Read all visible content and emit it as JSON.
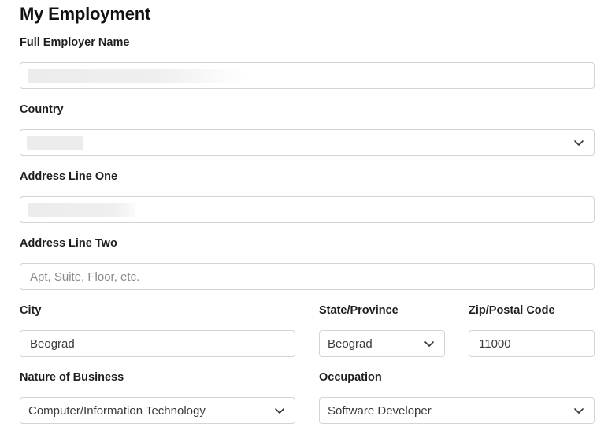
{
  "page": {
    "title": "My Employment"
  },
  "form": {
    "employer_name": {
      "label": "Full Employer Name",
      "value": ""
    },
    "country": {
      "label": "Country",
      "value": ""
    },
    "address_one": {
      "label": "Address Line One",
      "value": ""
    },
    "address_two": {
      "label": "Address Line Two",
      "placeholder": "Apt, Suite, Floor, etc.",
      "value": ""
    },
    "city": {
      "label": "City",
      "value": "Beograd"
    },
    "state": {
      "label": "State/Province",
      "value": "Beograd"
    },
    "zip": {
      "label": "Zip/Postal Code",
      "value": "11000"
    },
    "nature_of_business": {
      "label": "Nature of Business",
      "value": "Computer/Information Technology"
    },
    "occupation": {
      "label": "Occupation",
      "value": "Software Developer"
    }
  },
  "icons": {
    "dropdown": "chevron-down-icon"
  }
}
